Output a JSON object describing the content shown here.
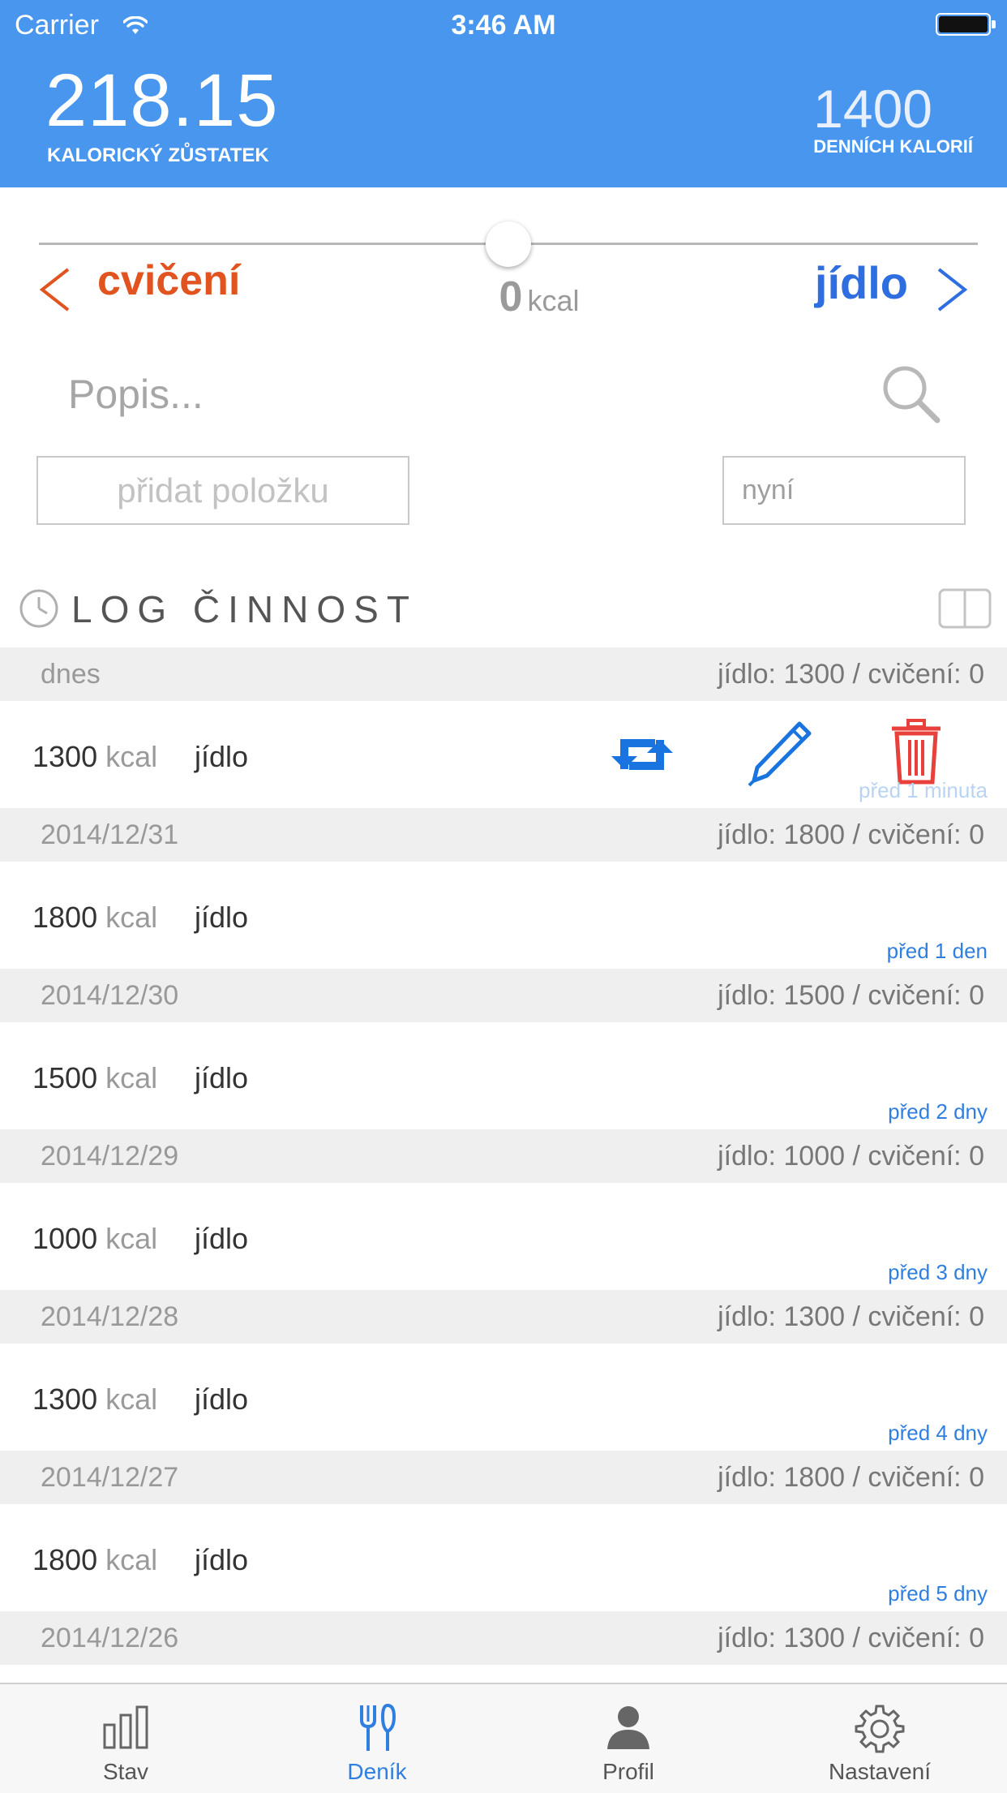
{
  "status_bar": {
    "carrier": "Carrier",
    "time": "3:46 AM"
  },
  "header": {
    "balance_value": "218.15",
    "balance_label": "KALORICKÝ ZŮSTATEK",
    "daily_value": "1400",
    "daily_label": "DENNÍCH KALORIÍ"
  },
  "slider": {
    "left_label": "cvičení",
    "right_label": "jídlo",
    "value": "0",
    "unit": "kcal",
    "position_fraction": 0.5
  },
  "form": {
    "description_placeholder": "Popis...",
    "add_button": "přidat položku",
    "time_value": "nyní"
  },
  "log": {
    "title": "LOG ČINNOST",
    "days": [
      {
        "date": "dnes",
        "totals": "jídlo: 1300 / cvičení: 0",
        "entry": {
          "kcal": "1300",
          "unit": "kcal",
          "type": "jídlo",
          "ago": "před 1 minuta"
        }
      },
      {
        "date": "2014/12/31",
        "totals": "jídlo: 1800 / cvičení: 0",
        "entry": {
          "kcal": "1800",
          "unit": "kcal",
          "type": "jídlo",
          "ago": "před 1 den"
        }
      },
      {
        "date": "2014/12/30",
        "totals": "jídlo: 1500 / cvičení: 0",
        "entry": {
          "kcal": "1500",
          "unit": "kcal",
          "type": "jídlo",
          "ago": "před 2 dny"
        }
      },
      {
        "date": "2014/12/29",
        "totals": "jídlo: 1000 / cvičení: 0",
        "entry": {
          "kcal": "1000",
          "unit": "kcal",
          "type": "jídlo",
          "ago": "před 3 dny"
        }
      },
      {
        "date": "2014/12/28",
        "totals": "jídlo: 1300 / cvičení: 0",
        "entry": {
          "kcal": "1300",
          "unit": "kcal",
          "type": "jídlo",
          "ago": "před 4 dny"
        }
      },
      {
        "date": "2014/12/27",
        "totals": "jídlo: 1800 / cvičení: 0",
        "entry": {
          "kcal": "1800",
          "unit": "kcal",
          "type": "jídlo",
          "ago": "před 5 dny"
        }
      },
      {
        "date": "2014/12/26",
        "totals": "jídlo: 1300 / cvičení: 0"
      }
    ]
  },
  "colors": {
    "header_bg": "#4996ef",
    "exercise": "#e1531f",
    "food": "#2f6ee0",
    "delete": "#e8403a",
    "action_blue": "#1a74e0"
  },
  "icons": {
    "repeat": "repeat-icon",
    "edit": "pencil-icon",
    "delete": "trash-icon",
    "search": "search-icon",
    "log": "clock-icon",
    "view": "book-icon"
  },
  "tabs": [
    {
      "label": "Stav",
      "icon": "bar-chart-icon",
      "active": false
    },
    {
      "label": "Deník",
      "icon": "fork-knife-icon",
      "active": true
    },
    {
      "label": "Profil",
      "icon": "person-icon",
      "active": false
    },
    {
      "label": "Nastavení",
      "icon": "gear-icon",
      "active": false
    }
  ]
}
